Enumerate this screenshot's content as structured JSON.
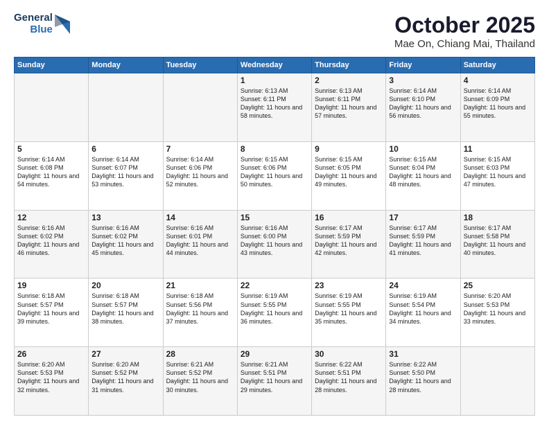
{
  "header": {
    "logo_general": "General",
    "logo_blue": "Blue",
    "title": "October 2025",
    "location": "Mae On, Chiang Mai, Thailand"
  },
  "days_of_week": [
    "Sunday",
    "Monday",
    "Tuesday",
    "Wednesday",
    "Thursday",
    "Friday",
    "Saturday"
  ],
  "weeks": [
    [
      {
        "day": "",
        "text": ""
      },
      {
        "day": "",
        "text": ""
      },
      {
        "day": "",
        "text": ""
      },
      {
        "day": "1",
        "text": "Sunrise: 6:13 AM\nSunset: 6:11 PM\nDaylight: 11 hours\nand 58 minutes."
      },
      {
        "day": "2",
        "text": "Sunrise: 6:13 AM\nSunset: 6:11 PM\nDaylight: 11 hours\nand 57 minutes."
      },
      {
        "day": "3",
        "text": "Sunrise: 6:14 AM\nSunset: 6:10 PM\nDaylight: 11 hours\nand 56 minutes."
      },
      {
        "day": "4",
        "text": "Sunrise: 6:14 AM\nSunset: 6:09 PM\nDaylight: 11 hours\nand 55 minutes."
      }
    ],
    [
      {
        "day": "5",
        "text": "Sunrise: 6:14 AM\nSunset: 6:08 PM\nDaylight: 11 hours\nand 54 minutes."
      },
      {
        "day": "6",
        "text": "Sunrise: 6:14 AM\nSunset: 6:07 PM\nDaylight: 11 hours\nand 53 minutes."
      },
      {
        "day": "7",
        "text": "Sunrise: 6:14 AM\nSunset: 6:06 PM\nDaylight: 11 hours\nand 52 minutes."
      },
      {
        "day": "8",
        "text": "Sunrise: 6:15 AM\nSunset: 6:06 PM\nDaylight: 11 hours\nand 50 minutes."
      },
      {
        "day": "9",
        "text": "Sunrise: 6:15 AM\nSunset: 6:05 PM\nDaylight: 11 hours\nand 49 minutes."
      },
      {
        "day": "10",
        "text": "Sunrise: 6:15 AM\nSunset: 6:04 PM\nDaylight: 11 hours\nand 48 minutes."
      },
      {
        "day": "11",
        "text": "Sunrise: 6:15 AM\nSunset: 6:03 PM\nDaylight: 11 hours\nand 47 minutes."
      }
    ],
    [
      {
        "day": "12",
        "text": "Sunrise: 6:16 AM\nSunset: 6:02 PM\nDaylight: 11 hours\nand 46 minutes."
      },
      {
        "day": "13",
        "text": "Sunrise: 6:16 AM\nSunset: 6:02 PM\nDaylight: 11 hours\nand 45 minutes."
      },
      {
        "day": "14",
        "text": "Sunrise: 6:16 AM\nSunset: 6:01 PM\nDaylight: 11 hours\nand 44 minutes."
      },
      {
        "day": "15",
        "text": "Sunrise: 6:16 AM\nSunset: 6:00 PM\nDaylight: 11 hours\nand 43 minutes."
      },
      {
        "day": "16",
        "text": "Sunrise: 6:17 AM\nSunset: 5:59 PM\nDaylight: 11 hours\nand 42 minutes."
      },
      {
        "day": "17",
        "text": "Sunrise: 6:17 AM\nSunset: 5:59 PM\nDaylight: 11 hours\nand 41 minutes."
      },
      {
        "day": "18",
        "text": "Sunrise: 6:17 AM\nSunset: 5:58 PM\nDaylight: 11 hours\nand 40 minutes."
      }
    ],
    [
      {
        "day": "19",
        "text": "Sunrise: 6:18 AM\nSunset: 5:57 PM\nDaylight: 11 hours\nand 39 minutes."
      },
      {
        "day": "20",
        "text": "Sunrise: 6:18 AM\nSunset: 5:57 PM\nDaylight: 11 hours\nand 38 minutes."
      },
      {
        "day": "21",
        "text": "Sunrise: 6:18 AM\nSunset: 5:56 PM\nDaylight: 11 hours\nand 37 minutes."
      },
      {
        "day": "22",
        "text": "Sunrise: 6:19 AM\nSunset: 5:55 PM\nDaylight: 11 hours\nand 36 minutes."
      },
      {
        "day": "23",
        "text": "Sunrise: 6:19 AM\nSunset: 5:55 PM\nDaylight: 11 hours\nand 35 minutes."
      },
      {
        "day": "24",
        "text": "Sunrise: 6:19 AM\nSunset: 5:54 PM\nDaylight: 11 hours\nand 34 minutes."
      },
      {
        "day": "25",
        "text": "Sunrise: 6:20 AM\nSunset: 5:53 PM\nDaylight: 11 hours\nand 33 minutes."
      }
    ],
    [
      {
        "day": "26",
        "text": "Sunrise: 6:20 AM\nSunset: 5:53 PM\nDaylight: 11 hours\nand 32 minutes."
      },
      {
        "day": "27",
        "text": "Sunrise: 6:20 AM\nSunset: 5:52 PM\nDaylight: 11 hours\nand 31 minutes."
      },
      {
        "day": "28",
        "text": "Sunrise: 6:21 AM\nSunset: 5:52 PM\nDaylight: 11 hours\nand 30 minutes."
      },
      {
        "day": "29",
        "text": "Sunrise: 6:21 AM\nSunset: 5:51 PM\nDaylight: 11 hours\nand 29 minutes."
      },
      {
        "day": "30",
        "text": "Sunrise: 6:22 AM\nSunset: 5:51 PM\nDaylight: 11 hours\nand 28 minutes."
      },
      {
        "day": "31",
        "text": "Sunrise: 6:22 AM\nSunset: 5:50 PM\nDaylight: 11 hours\nand 28 minutes."
      },
      {
        "day": "",
        "text": ""
      }
    ]
  ]
}
